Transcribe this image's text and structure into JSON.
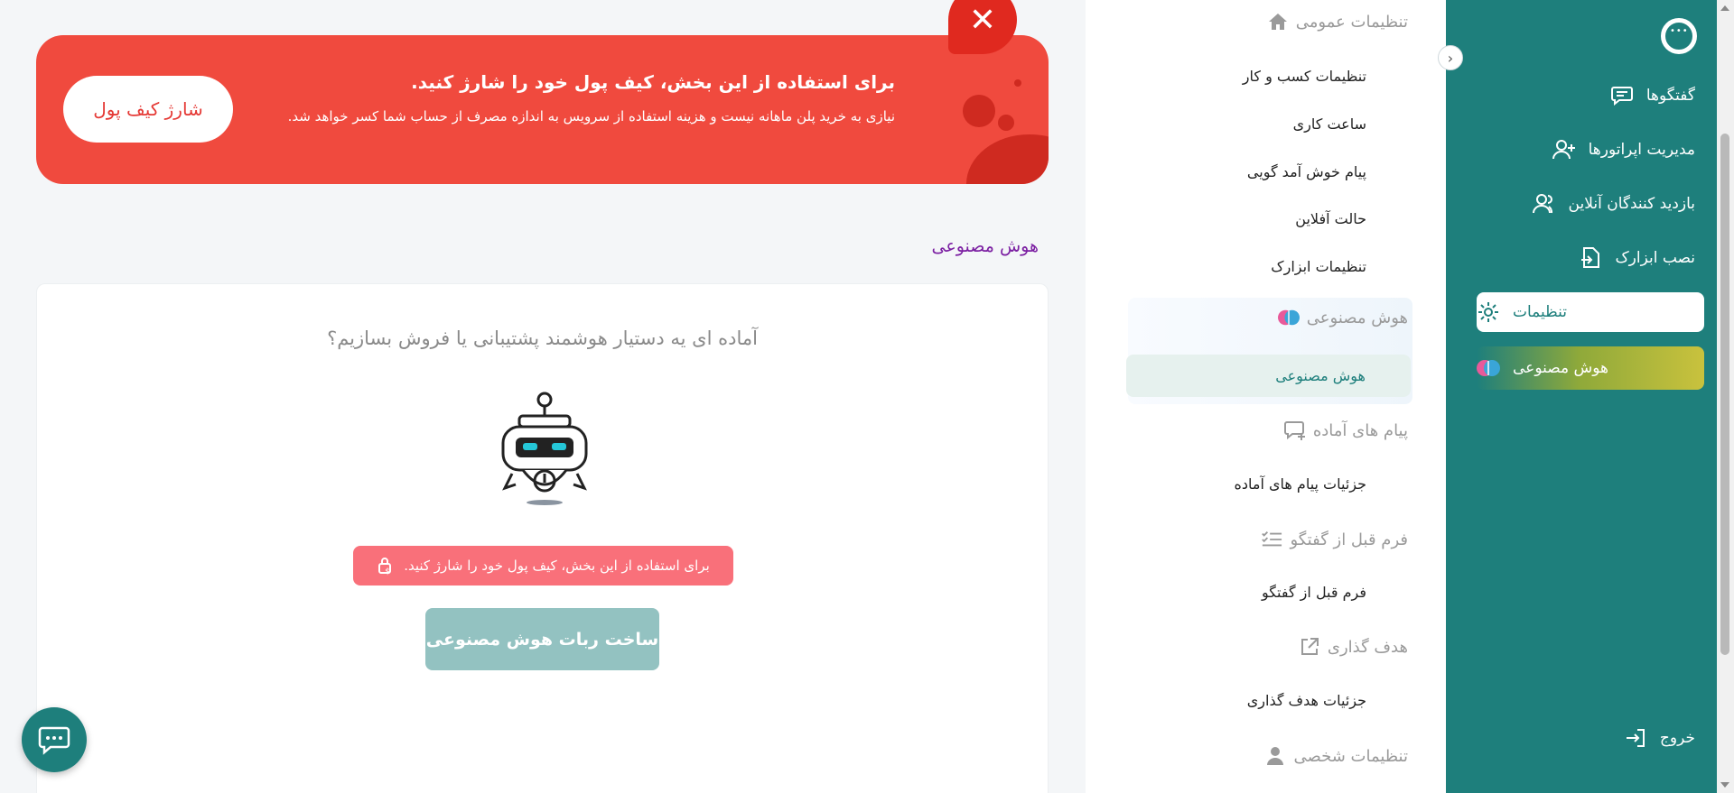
{
  "sidebar": {
    "items": [
      {
        "label": "گفتگوها",
        "icon": "chat-icon"
      },
      {
        "label": "مدیریت اپراتورها",
        "icon": "add-user-icon"
      },
      {
        "label": "بازدید کنندگان آنلاین",
        "icon": "users-icon"
      },
      {
        "label": "نصب ابزارک",
        "icon": "install-icon"
      },
      {
        "label": "تنظیمات",
        "icon": "gear-icon"
      },
      {
        "label": "هوش مصنوعی",
        "icon": "brain-icon"
      }
    ],
    "logout": "خروج"
  },
  "submenu": {
    "general_title": "تنظیمات عمومی",
    "general_items": [
      "تنظیمات کسب و کار",
      "ساعت کاری",
      "پیام خوش آمد گویی",
      "حالت آفلاین",
      "تنظیمات ابزارک"
    ],
    "ai_title": "هوش مصنوعی",
    "ai_item": "هوش مصنوعی",
    "ready_title": "پیام های آماده",
    "ready_item": "جزئیات پیام های آماده",
    "prechat_title": "فرم قبل از گفتگو",
    "prechat_item": "فرم قبل از گفتگو",
    "goal_title": "هدف گذاری",
    "goal_item": "جزئیات هدف گذاری",
    "personal_title": "تنظیمات شخصی"
  },
  "banner": {
    "title": "برای استفاده از این بخش، کیف پول خود را شارژ کنید.",
    "description": "نیازی به خرید پلن ماهانه نیست و هزینه استفاده از سرویس به اندازه مصرف از حساب شما کسر خواهد شد.",
    "charge_button": "شارژ کیف پول"
  },
  "main": {
    "section_title": "هوش مصنوعی",
    "question": "آماده ای یه دستیار هوشمند پشتیبانی یا فروش بسازیم؟",
    "lock_message": "برای استفاده از این بخش، کیف پول خود را شارژ کنید.",
    "build_button": "ساخت ربات هوش مصنوعی"
  },
  "colors": {
    "teal": "#1e7f7c",
    "banner_red": "#f04a3e",
    "pink_pill": "#f9707a",
    "button_disabled": "#93c2c1",
    "section_purple": "#7b1fa2"
  }
}
